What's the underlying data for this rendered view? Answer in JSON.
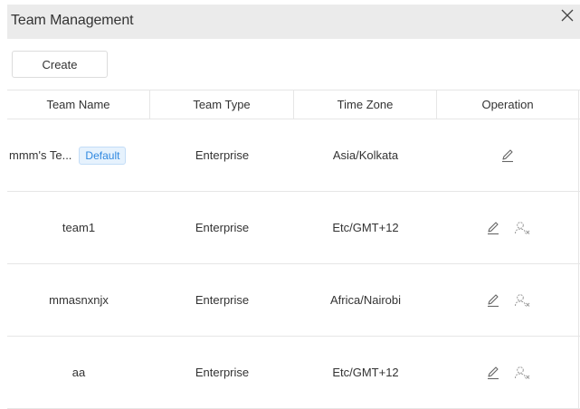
{
  "dialog": {
    "title": "Team Management",
    "close_icon": "close-icon"
  },
  "toolbar": {
    "create_label": "Create"
  },
  "table": {
    "columns": [
      "Team Name",
      "Team Type",
      "Time Zone",
      "Operation"
    ],
    "rows": [
      {
        "name": "mmm's Te...",
        "badge": "Default",
        "type": "Enterprise",
        "timezone": "Asia/Kolkata",
        "actions": [
          "edit-icon"
        ]
      },
      {
        "name": "team1",
        "badge": "",
        "type": "Enterprise",
        "timezone": "Etc/GMT+12",
        "actions": [
          "edit-icon",
          "remove-user-icon"
        ]
      },
      {
        "name": "mmasnxnjx",
        "badge": "",
        "type": "Enterprise",
        "timezone": "Africa/Nairobi",
        "actions": [
          "edit-icon",
          "remove-user-icon"
        ]
      },
      {
        "name": "aa",
        "badge": "",
        "type": "Enterprise",
        "timezone": "Etc/GMT+12",
        "actions": [
          "edit-icon",
          "remove-user-icon"
        ]
      }
    ]
  }
}
